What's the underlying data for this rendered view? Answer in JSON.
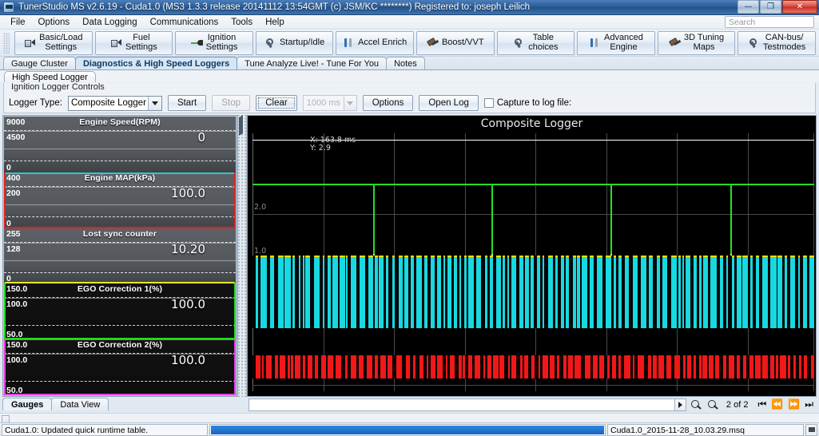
{
  "window": {
    "title": "TunerStudio MS v2.6.19 - Cuda1.0 (MS3 1.3.3 release    20141112 13:54GMT (c) JSM/KC ********) Registered to: joseph Leilich",
    "minimize": "—",
    "maximize": "❐",
    "close": "✕"
  },
  "menubar": {
    "items": [
      {
        "label": "File"
      },
      {
        "label": "Options"
      },
      {
        "label": "Data Logging"
      },
      {
        "label": "Communications"
      },
      {
        "label": "Tools"
      },
      {
        "label": "Help"
      }
    ],
    "search_placeholder": "Search"
  },
  "toolbar": {
    "buttons": [
      {
        "label": "Basic/Load\nSettings",
        "icon": "load-icon"
      },
      {
        "label": "Fuel\nSettings",
        "icon": "load-icon"
      },
      {
        "label": "Ignition\nSettings",
        "icon": "spark-icon"
      },
      {
        "label": "Startup/Idle",
        "icon": "wrench-icon"
      },
      {
        "label": "Accel Enrich",
        "icon": "tools-icon"
      },
      {
        "label": "Boost/VVT",
        "icon": "hammer-icon"
      },
      {
        "label": "Table\nchoices",
        "icon": "wrench-icon"
      },
      {
        "label": "Advanced\nEngine",
        "icon": "tools-icon"
      },
      {
        "label": "3D Tuning\nMaps",
        "icon": "hammer-icon"
      },
      {
        "label": "CAN-bus/\nTestmodes",
        "icon": "wrench-icon"
      }
    ]
  },
  "main_tabs": [
    {
      "label": "Gauge Cluster",
      "active": false
    },
    {
      "label": "Diagnostics & High Speed Loggers",
      "active": true
    },
    {
      "label": "Tune Analyze Live! - Tune For You",
      "active": false
    },
    {
      "label": "Notes",
      "active": false
    }
  ],
  "sub_tab": {
    "label": "High Speed Logger"
  },
  "logger_controls": {
    "group_title": "Ignition Logger Controls",
    "logger_type_label": "Logger Type:",
    "logger_type_value": "Composite Logger",
    "start_label": "Start",
    "stop_label": "Stop",
    "clear_label": "Clear",
    "interval_value": "1000 ms",
    "options_label": "Options",
    "open_log_label": "Open Log",
    "capture_label": "Capture to log file:"
  },
  "gauges": [
    {
      "title": "Engine Speed(RPM)",
      "max": "9000",
      "mid": "4500",
      "min": "0",
      "value": "0",
      "theme": "gray",
      "border_color": "transparent"
    },
    {
      "title": "Engine MAP(kPa)",
      "max": "400",
      "mid": "200",
      "min": "0",
      "value": "100.0",
      "theme": "gray",
      "border_color": "#e02020"
    },
    {
      "title": "Lost sync counter",
      "max": "255",
      "mid": "128",
      "min": "0",
      "value": "10.20",
      "theme": "gray",
      "border_color": "#e8e820"
    },
    {
      "title": "EGO Correction 1(%)",
      "max": "150.0",
      "mid": "100.0",
      "min": "50.0",
      "value": "100.0",
      "theme": "dark",
      "border_color": "#20d820"
    },
    {
      "title": "EGO Correction 2(%)",
      "max": "150.0",
      "mid": "100.0",
      "min": "50.0",
      "value": "100.0",
      "theme": "dark",
      "border_color": "#e040e0"
    }
  ],
  "gauge_accents": {
    "cyan": "#30c8c8",
    "red": "#e02020",
    "yellow": "#e8e820",
    "green": "#20d820",
    "magenta": "#e040e0"
  },
  "chart": {
    "title": "Composite Logger",
    "readout_x": "X: 163.8 ms",
    "readout_y": "Y: 2.9"
  },
  "chart_data": {
    "type": "line",
    "title": "Composite Logger",
    "xlabel": "",
    "ylabel": "",
    "x_unit": "ms",
    "cursor": {
      "x": 163.8,
      "y": 2.9
    },
    "ytick_labels": [
      "2.0",
      "1.0"
    ],
    "grid": true,
    "grid_columns": 8,
    "series": [
      {
        "name": "trigger-primary",
        "color": "#24e024",
        "style": "square-pulse-high",
        "baseline_level": 2.9,
        "pulse_low_level": 1.35,
        "pulse_positions_pct": [
          21.5,
          42.6,
          63.7,
          85.0
        ]
      },
      {
        "name": "composite-cyan-band",
        "color": "#18d8e0",
        "style": "dense-pulse-band",
        "top_border_color": "#ffe000",
        "y_top_pct": 47.5,
        "y_bottom_pct": 75.5
      },
      {
        "name": "composite-red-band",
        "color": "#f01818",
        "style": "dense-pulse-band",
        "y_top_pct": 86.0,
        "y_bottom_pct": 95.0
      }
    ]
  },
  "bottom_tabs": [
    {
      "label": "Gauges",
      "active": true
    },
    {
      "label": "Data View",
      "active": false
    }
  ],
  "navigation": {
    "page_current": "2",
    "of_label": "of",
    "page_total": "2",
    "first_icon": "⏮",
    "prev_icon": "⏪",
    "next_icon": "⏩",
    "last_icon": "⏭",
    "zoom_in_icon": "zoom-in-icon",
    "zoom_out_icon": "zoom-out-icon"
  },
  "statusbar": {
    "message": "Cuda1.0: Updated quick runtime table.",
    "progress_percent": 100,
    "filename": "Cuda1.0_2015-11-28_10.03.29.msq"
  }
}
